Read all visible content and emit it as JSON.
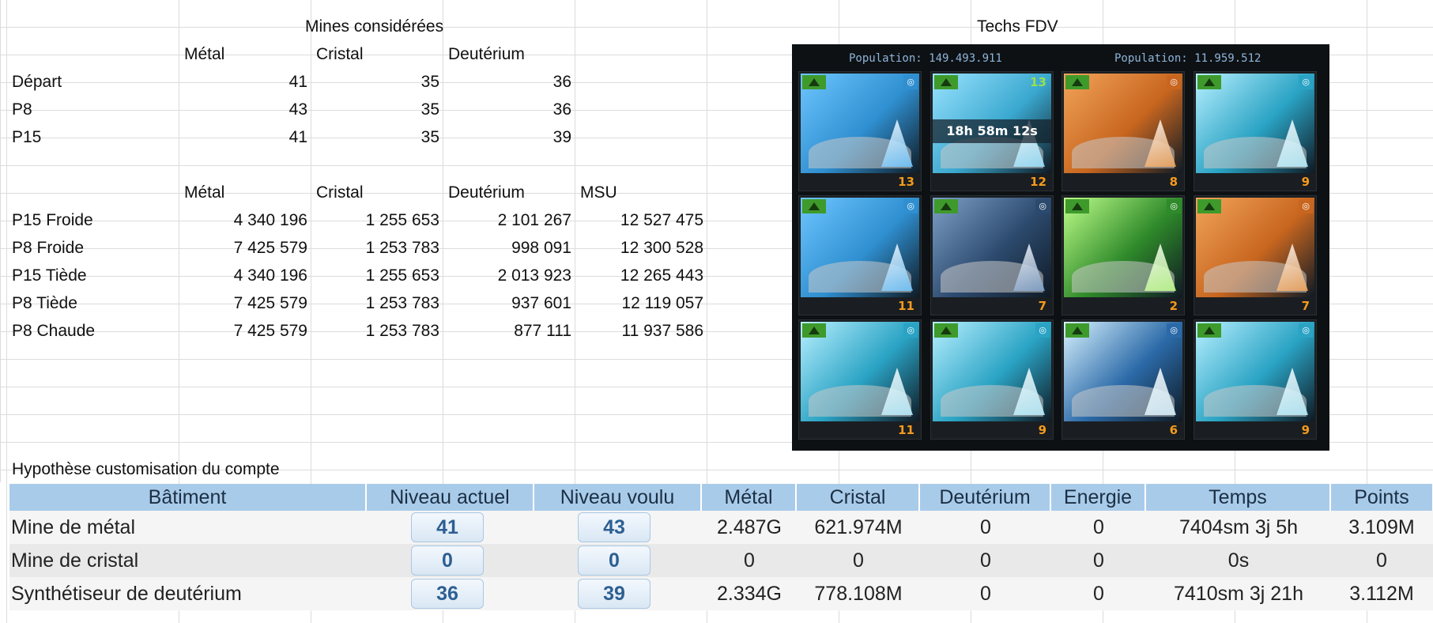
{
  "sheet": {
    "mines_title": "Mines considérées",
    "techs_title": "Techs FDV",
    "mines_headers": [
      "Métal",
      "Cristal",
      "Deutérium"
    ],
    "mines_rows": [
      {
        "label": "Départ",
        "values": [
          "41",
          "35",
          "36"
        ]
      },
      {
        "label": "P8",
        "values": [
          "43",
          "35",
          "36"
        ]
      },
      {
        "label": "P15",
        "values": [
          "41",
          "35",
          "39"
        ]
      }
    ],
    "prod_headers": [
      "Métal",
      "Cristal",
      "Deutérium",
      "MSU"
    ],
    "prod_rows": [
      {
        "label": "P15 Froide",
        "values": [
          "4 340 196",
          "1 255 653",
          "2 101 267",
          "12 527 475"
        ]
      },
      {
        "label": "P8 Froide",
        "values": [
          "7 425 579",
          "1 253 783",
          "998 091",
          "12 300 528"
        ]
      },
      {
        "label": "P15 Tiède",
        "values": [
          "4 340 196",
          "1 255 653",
          "2 013 923",
          "12 265 443"
        ]
      },
      {
        "label": "P8 Tiède",
        "values": [
          "7 425 579",
          "1 253 783",
          "937 601",
          "12 119 057"
        ]
      },
      {
        "label": "P8 Chaude",
        "values": [
          "7 425 579",
          "1 253 783",
          "877 111",
          "11 937 586"
        ]
      }
    ],
    "hypothesis_label": "Hypothèse customisation du compte"
  },
  "game": {
    "population_left": "Population: 149.493.911",
    "population_right": "Population: 11.959.512",
    "timer": "18h 58m 12s",
    "timer_top_level": "13",
    "tiles": [
      {
        "icon": "metal-chart-icon",
        "level": "13",
        "color": "#2f8fd0",
        "accent": "#6ec6ff"
      },
      {
        "icon": "deuterium-icon",
        "level": "12",
        "color": "#3aa8cf",
        "accent": "#9ae3ff"
      },
      {
        "icon": "metal-ore-icon",
        "level": "8",
        "color": "#c8661f",
        "accent": "#f2a45a"
      },
      {
        "icon": "crystal-deuterium-icon",
        "level": "9",
        "color": "#2aa3c4",
        "accent": "#b8f0ff"
      },
      {
        "icon": "metal-chart-icon",
        "level": "11",
        "color": "#2f8fd0",
        "accent": "#6ec6ff"
      },
      {
        "icon": "ship-icon",
        "level": "7",
        "color": "#2c4a6e",
        "accent": "#7fa0c8"
      },
      {
        "icon": "green-explosion-icon",
        "level": "2",
        "color": "#2f8a2a",
        "accent": "#bfff8a"
      },
      {
        "icon": "metal-ore-icon",
        "level": "7",
        "color": "#c8661f",
        "accent": "#f2a45a"
      },
      {
        "icon": "crystal-deuterium-icon",
        "level": "11",
        "color": "#2aa3c4",
        "accent": "#b8f0ff"
      },
      {
        "icon": "crystal-deuterium-icon",
        "level": "9",
        "color": "#2aa3c4",
        "accent": "#b8f0ff"
      },
      {
        "icon": "crystal-chart-icon",
        "level": "6",
        "color": "#2b6aa8",
        "accent": "#d9f3ff"
      },
      {
        "icon": "crystal-deuterium-icon",
        "level": "9",
        "color": "#2aa3c4",
        "accent": "#b8f0ff"
      }
    ]
  },
  "buildings": {
    "headers": [
      "Bâtiment",
      "Niveau actuel",
      "Niveau voulu",
      "Métal",
      "Cristal",
      "Deutérium",
      "Energie",
      "Temps",
      "Points"
    ],
    "rows": [
      {
        "name": "Mine de métal",
        "current": "41",
        "wanted": "43",
        "metal": "2.487G",
        "crystal": "621.974M",
        "deut": "0",
        "energy": "0",
        "time": "7404sm 3j 5h",
        "points": "3.109M"
      },
      {
        "name": "Mine de cristal",
        "current": "0",
        "wanted": "0",
        "metal": "0",
        "crystal": "0",
        "deut": "0",
        "energy": "0",
        "time": "0s",
        "points": "0"
      },
      {
        "name": "Synthétiseur de deutérium",
        "current": "36",
        "wanted": "39",
        "metal": "2.334G",
        "crystal": "778.108M",
        "deut": "0",
        "energy": "0",
        "time": "7410sm 3j 21h",
        "points": "3.112M"
      }
    ]
  },
  "colors": {
    "header_blue": "#a9cbea",
    "level_text": "#2d5f92",
    "game_level": "#f59b1c"
  }
}
